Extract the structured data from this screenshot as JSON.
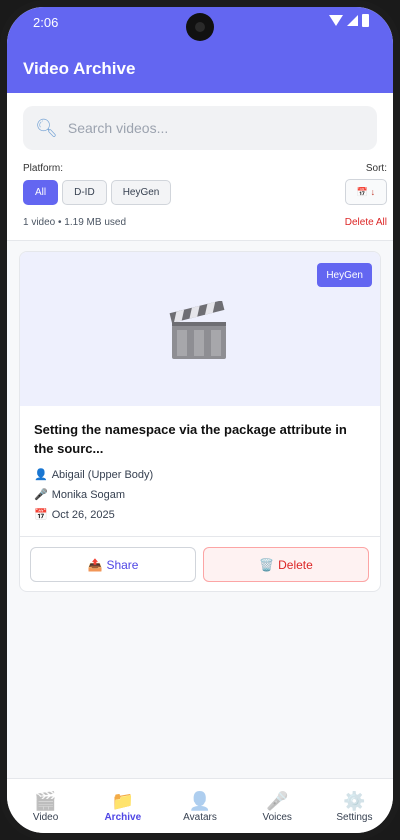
{
  "status": {
    "time": "2:06"
  },
  "header": {
    "title": "Video Archive"
  },
  "search": {
    "placeholder": "Search videos..."
  },
  "filters": {
    "platform_label": "Platform:",
    "sort_label": "Sort:",
    "platforms": [
      "All",
      "D-ID",
      "HeyGen"
    ],
    "selected_platform": "All",
    "sort_glyph": "📅 ↓"
  },
  "summary": {
    "usage": "1 video • 1.19 MB used",
    "delete_all": "Delete All"
  },
  "video": {
    "platform_badge": "HeyGen",
    "title": "Setting the namespace via the package attribute in the sourc...",
    "avatar_icon": "👤",
    "avatar": "Abigail (Upper Body)",
    "voice_icon": "🎤",
    "voice": "Monika Sogam",
    "date_icon": "📅",
    "date": "Oct 26, 2025",
    "share_icon": "📤",
    "share_label": "Share",
    "delete_icon": "🗑️",
    "delete_label": "Delete"
  },
  "nav": {
    "active": "Archive",
    "items": [
      {
        "icon": "🎬",
        "label": "Video"
      },
      {
        "icon": "📁",
        "label": "Archive"
      },
      {
        "icon": "👤",
        "label": "Avatars"
      },
      {
        "icon": "🎤",
        "label": "Voices"
      },
      {
        "icon": "⚙️",
        "label": "Settings"
      }
    ]
  },
  "colors": {
    "primary": "#6366f1",
    "danger": "#dc2626",
    "background": "#f7f8fa"
  }
}
